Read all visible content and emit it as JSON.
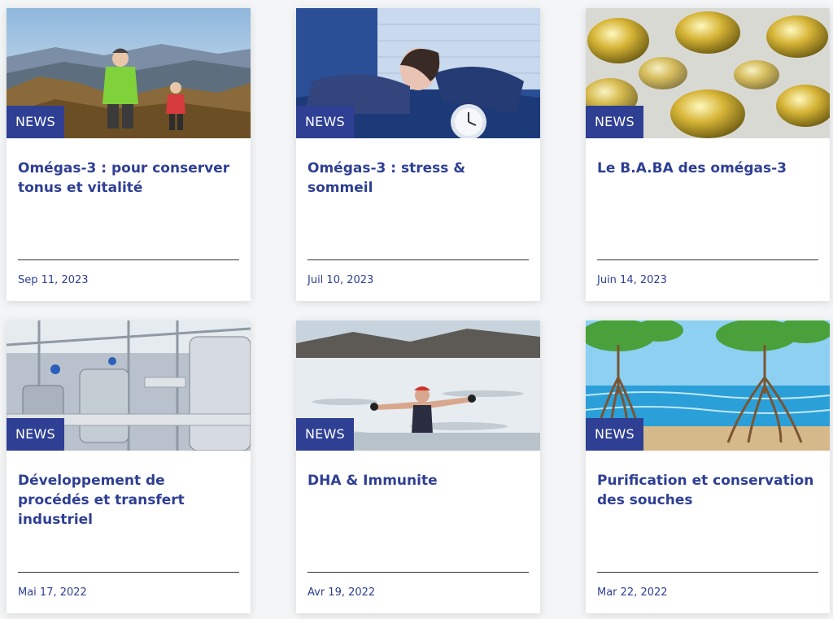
{
  "cards": [
    {
      "badge": "NEWS",
      "image": "hikers-mountain",
      "title": "Omégas-3 : pour conserver tonus et vitalité",
      "date": "Sep 11, 2023"
    },
    {
      "badge": "NEWS",
      "image": "woman-insomnia-alarm-clock",
      "title": "Omégas-3 : stress & sommeil",
      "date": "Juil 10, 2023"
    },
    {
      "badge": "NEWS",
      "image": "omega3-softgel-capsules",
      "title": "Le B.A.BA des omégas-3",
      "date": "Juin 14, 2023"
    },
    {
      "badge": "NEWS",
      "image": "industrial-process-plant",
      "title": "Développement de procédés et transfert industriel",
      "date": "Mai 17, 2022"
    },
    {
      "badge": "NEWS",
      "image": "cold-water-swimmer",
      "title": "DHA & Immunite",
      "date": "Avr 19, 2022"
    },
    {
      "badge": "NEWS",
      "image": "mangrove-roots-illustration",
      "title": "Purification et conservation des souches",
      "date": "Mar 22, 2022"
    }
  ],
  "colors": {
    "accent": "#2e3f94",
    "card_bg": "#ffffff",
    "page_bg": "#f4f5f7"
  }
}
